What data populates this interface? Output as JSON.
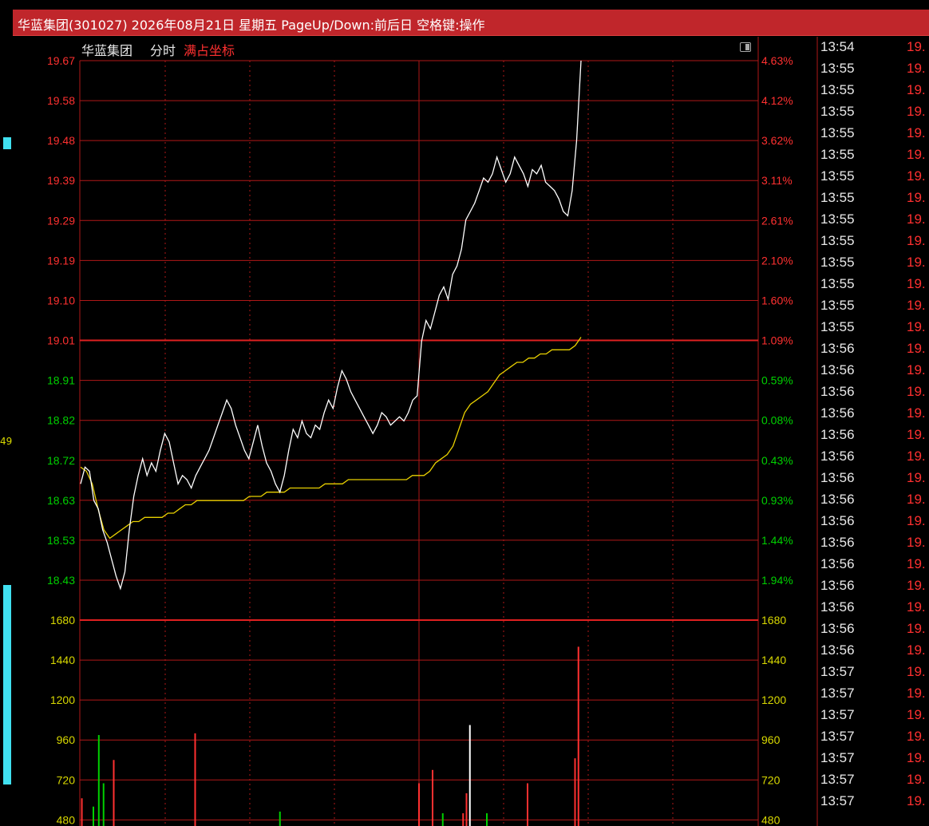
{
  "window": {
    "title": "华蓝集团(301027) 2026年08月21日 星期五 PageUp/Down:前后日 空格键:操作"
  },
  "chart_header": {
    "stock_name": "华蓝集团",
    "view": "分时",
    "scale_mode": "满占坐标"
  },
  "left_panel": {
    "fragment_label": "49"
  },
  "colors": {
    "up": "#ff3030",
    "down": "#00d000",
    "grid": "#b01818",
    "price_line": "#ffffff",
    "avg_line": "#e8d000",
    "title_bar": "#c0262b",
    "volume_label": "#d8d800"
  },
  "chart_data": {
    "type": "line",
    "title": "华蓝集团 分时",
    "price_axis": [
      19.67,
      19.58,
      19.48,
      19.39,
      19.29,
      19.19,
      19.1,
      19.01,
      18.91,
      18.82,
      18.72,
      18.63,
      18.53,
      18.43
    ],
    "pct_axis": [
      "4.63%",
      "4.12%",
      "3.62%",
      "3.11%",
      "2.61%",
      "2.10%",
      "1.60%",
      "1.09%",
      "0.59%",
      "0.08%",
      "0.43%",
      "0.93%",
      "1.44%",
      "1.94%"
    ],
    "prev_close": 19.01,
    "volume_axis": [
      1680,
      1440,
      1200,
      960,
      720,
      480
    ],
    "ylim": [
      18.43,
      19.67
    ],
    "volume_ylim": [
      0,
      1680
    ],
    "series": [
      {
        "values": [
          18.66,
          18.7,
          18.69,
          18.62,
          18.6,
          18.55,
          18.52,
          18.48,
          18.44,
          18.41,
          18.45,
          18.55,
          18.63,
          18.68,
          18.72,
          18.68,
          18.71,
          18.69,
          18.74,
          18.78,
          18.76,
          18.71,
          18.66,
          18.68,
          18.67,
          18.65,
          18.68,
          18.7,
          18.72,
          18.74,
          18.77,
          18.8,
          18.83,
          18.86,
          18.84,
          18.8,
          18.77,
          18.74,
          18.72,
          18.76,
          18.8,
          18.75,
          18.71,
          18.69,
          18.66,
          18.64,
          18.68,
          18.74,
          18.79,
          18.77,
          18.81,
          18.78,
          18.77,
          18.8,
          18.79,
          18.83,
          18.86,
          18.84,
          18.89,
          18.93,
          18.91,
          18.88,
          18.86,
          18.84,
          18.82,
          18.8,
          18.78,
          18.8,
          18.83,
          18.82,
          18.8,
          18.81,
          18.82,
          18.81,
          18.83,
          18.86,
          18.87,
          19.0,
          19.05,
          19.03,
          19.07,
          19.11,
          19.13,
          19.1,
          19.16,
          19.18,
          19.22,
          19.29,
          19.31,
          19.33,
          19.36,
          19.39,
          19.38,
          19.4,
          19.44,
          19.41,
          19.38,
          19.4,
          19.44,
          19.42,
          19.4,
          19.37,
          19.41,
          19.4,
          19.42,
          19.38,
          19.37,
          19.36,
          19.34,
          19.31,
          19.3,
          19.36,
          19.48,
          19.67
        ]
      },
      {
        "values": [
          18.7,
          18.69,
          18.66,
          18.6,
          18.55,
          18.53,
          18.54,
          18.55,
          18.56,
          18.57,
          18.57,
          18.58,
          18.58,
          18.58,
          18.58,
          18.59,
          18.59,
          18.6,
          18.61,
          18.61,
          18.62,
          18.62,
          18.62,
          18.62,
          18.62,
          18.62,
          18.62,
          18.62,
          18.62,
          18.63,
          18.63,
          18.63,
          18.64,
          18.64,
          18.64,
          18.64,
          18.65,
          18.65,
          18.65,
          18.65,
          18.65,
          18.65,
          18.66,
          18.66,
          18.66,
          18.66,
          18.67,
          18.67,
          18.67,
          18.67,
          18.67,
          18.67,
          18.67,
          18.67,
          18.67,
          18.67,
          18.67,
          18.68,
          18.68,
          18.68,
          18.69,
          18.71,
          18.72,
          18.73,
          18.75,
          18.79,
          18.83,
          18.85,
          18.86,
          18.87,
          18.88,
          18.9,
          18.92,
          18.93,
          18.94,
          18.95,
          18.95,
          18.96,
          18.96,
          18.97,
          18.97,
          18.98,
          18.98,
          18.98,
          18.98,
          18.99,
          19.01
        ]
      }
    ],
    "volume": [
      {
        "t": 0.003,
        "v": 610,
        "c": "up"
      },
      {
        "t": 0.02,
        "v": 560,
        "c": "down"
      },
      {
        "t": 0.028,
        "v": 990,
        "c": "down"
      },
      {
        "t": 0.035,
        "v": 700,
        "c": "down"
      },
      {
        "t": 0.05,
        "v": 840,
        "c": "up"
      },
      {
        "t": 0.17,
        "v": 1000,
        "c": "up"
      },
      {
        "t": 0.295,
        "v": 530,
        "c": "down"
      },
      {
        "t": 0.5,
        "v": 700,
        "c": "up"
      },
      {
        "t": 0.52,
        "v": 780,
        "c": "up"
      },
      {
        "t": 0.535,
        "v": 520,
        "c": "down"
      },
      {
        "t": 0.565,
        "v": 520,
        "c": "up"
      },
      {
        "t": 0.57,
        "v": 640,
        "c": "up"
      },
      {
        "t": 0.575,
        "v": 1050,
        "c": "white"
      },
      {
        "t": 0.6,
        "v": 520,
        "c": "down"
      },
      {
        "t": 0.66,
        "v": 700,
        "c": "up"
      },
      {
        "t": 0.73,
        "v": 850,
        "c": "up"
      },
      {
        "t": 0.735,
        "v": 1520,
        "c": "up"
      }
    ]
  },
  "tick_list": [
    {
      "time": "13:54",
      "price": "19."
    },
    {
      "time": "13:55",
      "price": "19."
    },
    {
      "time": "13:55",
      "price": "19."
    },
    {
      "time": "13:55",
      "price": "19."
    },
    {
      "time": "13:55",
      "price": "19."
    },
    {
      "time": "13:55",
      "price": "19."
    },
    {
      "time": "13:55",
      "price": "19."
    },
    {
      "time": "13:55",
      "price": "19."
    },
    {
      "time": "13:55",
      "price": "19."
    },
    {
      "time": "13:55",
      "price": "19."
    },
    {
      "time": "13:55",
      "price": "19."
    },
    {
      "time": "13:55",
      "price": "19."
    },
    {
      "time": "13:55",
      "price": "19."
    },
    {
      "time": "13:55",
      "price": "19."
    },
    {
      "time": "13:56",
      "price": "19."
    },
    {
      "time": "13:56",
      "price": "19."
    },
    {
      "time": "13:56",
      "price": "19."
    },
    {
      "time": "13:56",
      "price": "19."
    },
    {
      "time": "13:56",
      "price": "19."
    },
    {
      "time": "13:56",
      "price": "19."
    },
    {
      "time": "13:56",
      "price": "19."
    },
    {
      "time": "13:56",
      "price": "19."
    },
    {
      "time": "13:56",
      "price": "19."
    },
    {
      "time": "13:56",
      "price": "19."
    },
    {
      "time": "13:56",
      "price": "19."
    },
    {
      "time": "13:56",
      "price": "19."
    },
    {
      "time": "13:56",
      "price": "19."
    },
    {
      "time": "13:56",
      "price": "19."
    },
    {
      "time": "13:56",
      "price": "19."
    },
    {
      "time": "13:57",
      "price": "19."
    },
    {
      "time": "13:57",
      "price": "19."
    },
    {
      "time": "13:57",
      "price": "19."
    },
    {
      "time": "13:57",
      "price": "19."
    },
    {
      "time": "13:57",
      "price": "19."
    },
    {
      "time": "13:57",
      "price": "19."
    },
    {
      "time": "13:57",
      "price": "19."
    }
  ]
}
